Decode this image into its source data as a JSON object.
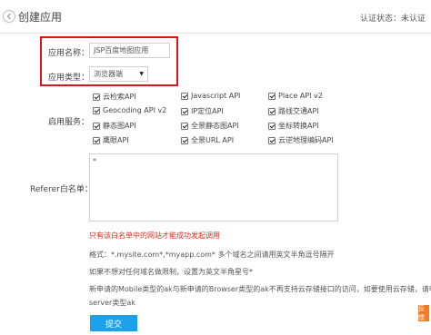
{
  "header": {
    "title": "创建应用",
    "status": "认证状态：未认证"
  },
  "form": {
    "app_name": {
      "label": "应用名称：",
      "value": "JSP百度地图应用"
    },
    "app_type": {
      "label": "应用类型：",
      "selected": "浏览器端"
    },
    "services": {
      "label": "启用服务：",
      "items": [
        "云检索API",
        "Javascript API",
        "Place API v2",
        "Geocoding API v2",
        "IP定位API",
        "路线交通API",
        "静态图API",
        "全景静态图API",
        "坐标转换API",
        "鹰眼API",
        "全景URL API",
        "云逆地理编码API"
      ]
    },
    "referer": {
      "label": "Referer白名单：",
      "value": "*"
    }
  },
  "notes": {
    "warning": "只有该白名单中的网站才能成功发起调用",
    "format": "格式：*.mysite.com*,*myapp.com* 多个域名之间请用英文半角逗号隔开",
    "no_limit": "如果不想对任何域名做限制，设置为英文半角星号*",
    "line1": "新申请的Mobile类型的ak与新申请的Browser类型的ak不再支持云存储接口的访问，如要使用云存储，请申请",
    "line2": "server类型ak"
  },
  "submit_label": "提交",
  "feedback_label": "反馈",
  "colors": {
    "accent": "#1da1ea",
    "highlight_box": "#d9141b",
    "warning_text": "#d62c1a"
  }
}
